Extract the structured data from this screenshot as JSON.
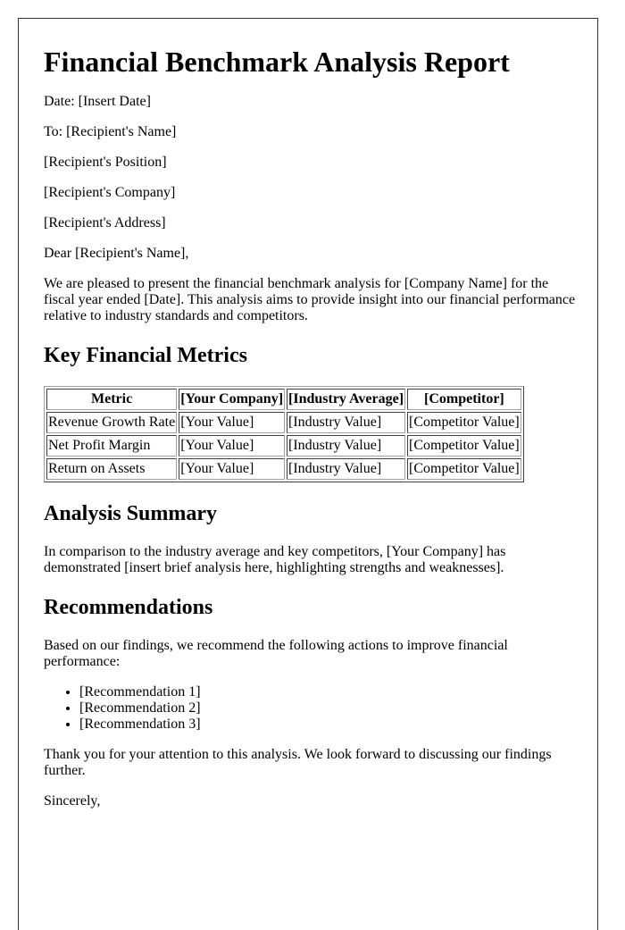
{
  "document": {
    "title": "Financial Benchmark Analysis Report",
    "date_line": "Date: [Insert Date]",
    "to_line": "To: [Recipient's Name]",
    "recipient_position": "[Recipient's Position]",
    "recipient_company": "[Recipient's Company]",
    "recipient_address": "[Recipient's Address]",
    "salutation": "Dear [Recipient's Name],",
    "intro": "We are pleased to present the financial benchmark analysis for [Company Name] for the fiscal year ended [Date]. This analysis aims to provide insight into our financial performance relative to industry standards and competitors.",
    "sections": {
      "metrics": {
        "heading": "Key Financial Metrics",
        "table": {
          "headers": [
            "Metric",
            "[Your Company]",
            "[Industry Average]",
            "[Competitor]"
          ],
          "rows": [
            [
              "Revenue Growth Rate",
              "[Your Value]",
              "[Industry Value]",
              "[Competitor Value]"
            ],
            [
              "Net Profit Margin",
              "[Your Value]",
              "[Industry Value]",
              "[Competitor Value]"
            ],
            [
              "Return on Assets",
              "[Your Value]",
              "[Industry Value]",
              "[Competitor Value]"
            ]
          ]
        }
      },
      "summary": {
        "heading": "Analysis Summary",
        "text": "In comparison to the industry average and key competitors, [Your Company] has demonstrated [insert brief analysis here, highlighting strengths and weaknesses]."
      },
      "recommendations": {
        "heading": "Recommendations",
        "intro": "Based on our findings, we recommend the following actions to improve financial performance:",
        "items": [
          "[Recommendation 1]",
          "[Recommendation 2]",
          "[Recommendation 3]"
        ]
      }
    },
    "closing": "Thank you for your attention to this analysis. We look forward to discussing our findings further.",
    "sign_off": "Sincerely,"
  }
}
